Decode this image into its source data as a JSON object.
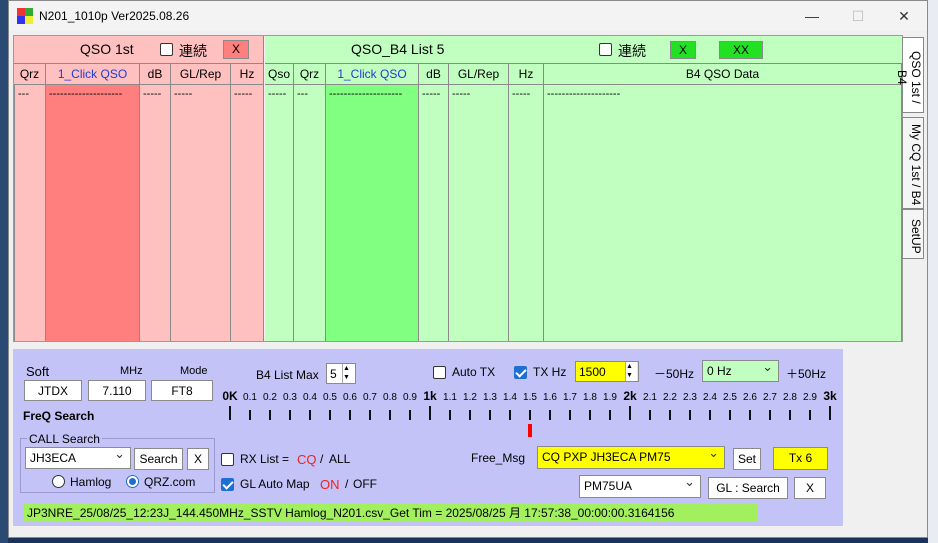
{
  "window": {
    "title": "N201_1010p   Ver2025.08.26",
    "min": "—",
    "max": "☐",
    "close": "✕"
  },
  "qso1st": {
    "title": "QSO  1st",
    "renzoku_label": "連続",
    "x_label": "X",
    "columns": [
      "Qrz",
      "1_Click QSO",
      "dB",
      "GL/Rep",
      "Hz"
    ],
    "row": [
      "---",
      "--------------------",
      "-----",
      "-----",
      "-----"
    ]
  },
  "qsob4": {
    "title": "QSO_B4   List  5",
    "renzoku_label": "連続",
    "x_label": "X",
    "xx_label": "XX",
    "columns": [
      "Qso",
      "Qrz",
      "1_Click QSO",
      "dB",
      "GL/Rep",
      "Hz",
      "B4 QSO Data"
    ],
    "row": [
      "-----",
      "---",
      "--------------------",
      "-----",
      "-----",
      "-----",
      "--------------------"
    ]
  },
  "sidetabs": [
    "QSO 1st / B4",
    "My CQ 1st / B4",
    "SetUP"
  ],
  "settings": {
    "soft_label": "Soft",
    "mhz_label": "MHz",
    "mode_label": "Mode",
    "soft": "JTDX",
    "mhz": "7.110",
    "mode": "FT8",
    "freq_search": "FreQ Search",
    "b4_list_max_label": "B4 List Max",
    "b4_list_max": "5",
    "auto_tx": "Auto TX",
    "tx_hz_label": "TX Hz",
    "tx_hz": "1500",
    "minus50": "－50Hz",
    "plus50": "＋50Hz",
    "hz_offset": "0 Hz",
    "call_search_label": "CALL Search",
    "call": "JH3ECA",
    "search_btn": "Search",
    "x_btn": "X",
    "hamlog": "Hamlog",
    "qrz": "QRZ.com",
    "rx_list_label": "RX List =",
    "cq": "CQ",
    "slash": "/",
    "all": "ALL",
    "gl_auto_map": "GL Auto Map",
    "on": "ON",
    "off": "OFF",
    "free_msg_label": "Free_Msg",
    "free_msg": "CQ PXP JH3ECA PM75",
    "set_btn": "Set",
    "tx_btn": "Tx 6",
    "gl_value": "PM75UA",
    "gl_search": "GL : Search",
    "gl_x": "X",
    "status": "JP3NRE_25/08/25_12:23J_144.450MHz_SSTV       Hamlog_N201.csv_Get Tim = 2025/08/25 月 17:57:38_00:00:00.3164156"
  },
  "scale": {
    "labels": [
      "0K",
      "0.1",
      "0.2",
      "0.3",
      "0.4",
      "0.5",
      "0.6",
      "0.7",
      "0.8",
      "0.9",
      "1k",
      "1.1",
      "1.2",
      "1.3",
      "1.4",
      "1.5",
      "1.6",
      "1.7",
      "1.8",
      "1.9",
      "2k",
      "2.1",
      "2.2",
      "2.3",
      "2.4",
      "2.5",
      "2.6",
      "2.7",
      "2.8",
      "2.9",
      "3k"
    ],
    "marker_hz": 1500,
    "colors": {
      "marker": "#ff0000"
    }
  },
  "colors": {
    "pink": "#ffc0c0",
    "red": "#ff7f7f",
    "lightgreen": "#c0ffc0",
    "green": "#80ff80",
    "panel": "#c3c3f7",
    "status": "#a3f05f",
    "yellow": "#ffff00"
  }
}
